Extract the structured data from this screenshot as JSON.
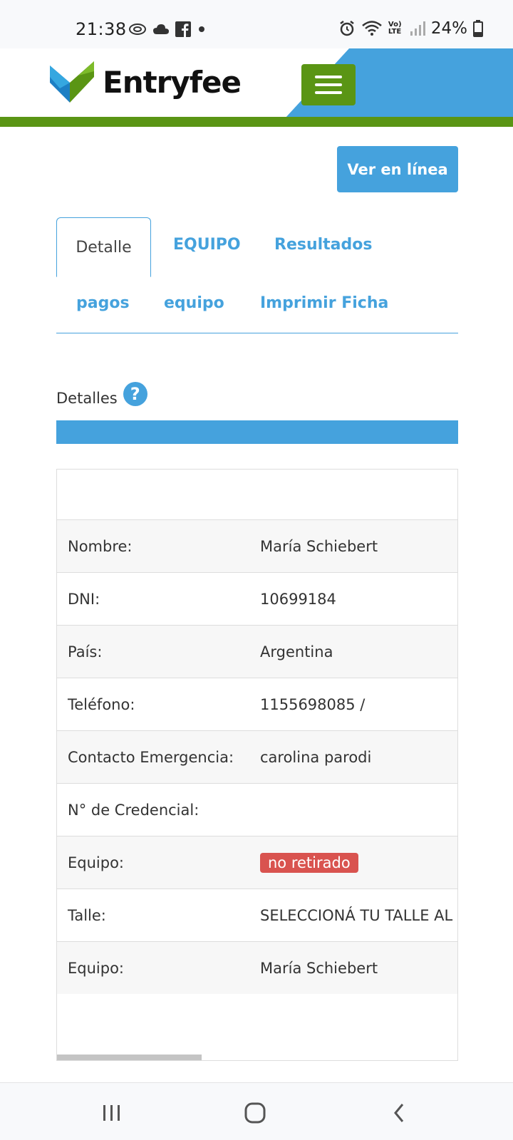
{
  "status_bar": {
    "time": "21:38",
    "battery": "24%",
    "network": "Vo) LTE"
  },
  "header": {
    "logo_text": "Entryfee",
    "colors": {
      "blue": "#45a2dd",
      "green": "#5a9514"
    }
  },
  "actions": {
    "ver_en_linea": "Ver en línea"
  },
  "tabs": [
    {
      "label": "Detalle",
      "active": true
    },
    {
      "label": "EQUIPO",
      "active": false
    },
    {
      "label": "Resultados",
      "active": false
    },
    {
      "label": "pagos",
      "active": false
    },
    {
      "label": "equipo",
      "active": false
    },
    {
      "label": "Imprimir Ficha",
      "active": false
    }
  ],
  "section": {
    "title": "Detalles",
    "help_icon": "?"
  },
  "details": {
    "rows": [
      {
        "label": "Nombre:",
        "value": "María Schiebert"
      },
      {
        "label": "DNI:",
        "value": "10699184"
      },
      {
        "label": "País:",
        "value": "Argentina"
      },
      {
        "label": "Teléfono:",
        "value": "1155698085 /"
      },
      {
        "label": "Contacto Emergencia:",
        "value": "carolina parodi"
      },
      {
        "label": "N° de Credencial:",
        "value": ""
      },
      {
        "label": "Equipo:",
        "value": "no retirado",
        "badge": true
      },
      {
        "label": "Talle:",
        "value": "SELECCIONÁ TU TALLE AL"
      },
      {
        "label": "Equipo:",
        "value": "María Schiebert"
      }
    ]
  }
}
